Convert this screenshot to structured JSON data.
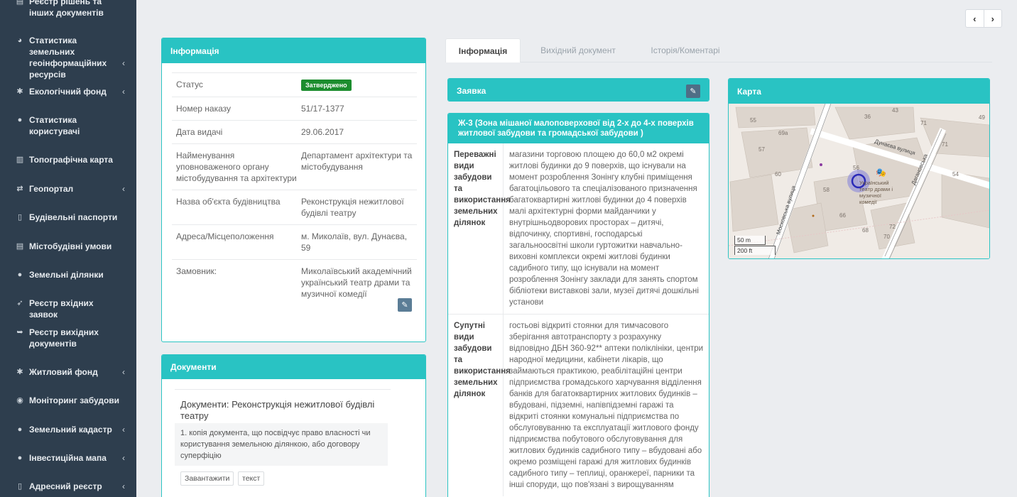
{
  "sidebar": {
    "items": [
      {
        "label": "Реєстр рішень та інших документів",
        "icon": "document-icon",
        "chevron": false
      },
      {
        "label": "Статистика земельних геоінформаційних ресурсів",
        "icon": "pie-chart-icon",
        "chevron": true
      },
      {
        "label": "Екологічний фонд",
        "icon": "tree-icon",
        "chevron": true
      },
      {
        "label": "Статистика користувачі",
        "icon": "user-icon",
        "chevron": false
      },
      {
        "label": "Топографічна карта",
        "icon": "map-icon",
        "chevron": false
      },
      {
        "label": "Геопортал",
        "icon": "retweet-icon",
        "chevron": true
      },
      {
        "label": "Будівельні паспорти",
        "icon": "file-icon",
        "chevron": false
      },
      {
        "label": "Містобудівні умови",
        "icon": "file-text-icon",
        "chevron": false
      },
      {
        "label": "Земельні ділянки",
        "icon": "globe-icon",
        "chevron": false
      },
      {
        "label": "Реєстр вхідних заявок",
        "icon": "send-icon",
        "chevron": false
      },
      {
        "label": "Реєстр вихідних документів",
        "icon": "sign-out-icon",
        "chevron": false
      },
      {
        "label": "Житловий фонд",
        "icon": "asterisk-icon",
        "chevron": true
      },
      {
        "label": "Моніторинг забудови",
        "icon": "eye-icon",
        "chevron": false
      },
      {
        "label": "Земельний кадастр",
        "icon": "globe-icon",
        "chevron": true
      },
      {
        "label": "Інвестиційна мапа",
        "icon": "globe-icon",
        "chevron": true
      },
      {
        "label": "Адресний реєстр",
        "icon": "file-icon",
        "chevron": true
      }
    ]
  },
  "info_panel": {
    "title": "Інформація",
    "rows": [
      {
        "key": "Статус",
        "value": "Затверджено",
        "type": "badge"
      },
      {
        "key": "Номер наказу",
        "value": "51/17-1377",
        "type": "text"
      },
      {
        "key": "Дата видачі",
        "value": "29.06.2017",
        "type": "text"
      },
      {
        "key": "Найменування уповноваженого органу містобудування та архітектури",
        "value": "Департамент архітектури та містобудування",
        "type": "text"
      },
      {
        "key": "Назва об'єкта будівництва",
        "value": "Реконструкція нежитлової будівлі театру",
        "type": "text"
      },
      {
        "key": "Адреса/Місцеположення",
        "value": "м. Миколаїв, вул. Дунаєва, 59",
        "type": "text"
      },
      {
        "key": "Замовник:",
        "value": "Миколаївський академічний український театр драми та музичної комедії",
        "type": "link"
      }
    ]
  },
  "documents_panel": {
    "title": "Документи",
    "doc_title": "Документи: Реконструкція нежитлової будівлі театру",
    "doc_item": "1. копія документа, що посвідчує право власності чи користування земельною ділянкою, або договору суперфіцію",
    "buttons": {
      "download": "Завантажити",
      "text": "текст"
    }
  },
  "tabs": [
    {
      "label": "Інформація",
      "active": true
    },
    {
      "label": "Вихідний документ",
      "active": false
    },
    {
      "label": "Історія/Коментарі",
      "active": false
    }
  ],
  "request_panel": {
    "title": "Заявка"
  },
  "zone_panel": {
    "title": "Ж-3 (Зона мішаної малоповерхової від 2-х до 4-х поверхів житлової забудови та громадської забудови )",
    "rows": [
      {
        "key": "Переважні види забудови та використання земельних ділянок",
        "value": "магазини торговою площею до 60,0 м2 окремі житлові будинки до 9 поверхів, що існували на момент розроблення Зонінгу клубні приміщення багатоцільового та спеціалізованого призначення багатоквартирні житлові будинки до 4 поверхів малі архітектурні форми майданчики у внутрішньодворових просторах – дитячі, відпочинку, спортивні, господарські загальноосвітні школи гуртожитки навчально-виховні комплекси окремі житлові будинки садибного типу, що існували на момент розроблення Зонінгу заклади для занять спортом бібліотеки виставкові зали, музеї дитячі дошкільні установи"
      },
      {
        "key": "Супутні види забудови та використання земельних ділянок",
        "value": "гостьові відкриті стоянки для тимчасового зберігання автотранспорту з розрахунку відповідно ДБН 360-92** аптеки поліклініки, центри народної медицини, кабінети лікарів, що займаються практикою, реабілітаційні центри підприємства громадського харчування відділення банків для багатоквартирних житлових будинків – вбудовані, підземні, напівпідземні гаражі та відкриті стоянки комунальні підприємства по обслуговуванню та експлуатації житлового фонду підприємства побутового обслуговування для житлових будинків садибного типу – вбудовані або окремо розміщені гаражі для житлових будинків садибного типу – теплиці, оранжереї, парники та інші споруди, що пов'язані з вирощуванням"
      }
    ]
  },
  "map_panel": {
    "title": "Карта",
    "streets": {
      "s1": "Дунаєва вулиця",
      "s2": "Московська вулиця",
      "s3": "Дагановська"
    },
    "poi_label": "Український театр драми і музичної комедії",
    "scale_m": "50 m",
    "scale_ft": "200 ft",
    "house_numbers": {
      "n1": "36",
      "n2": "43",
      "n3": "55",
      "n4": "69а",
      "n5": "57",
      "n6": "56",
      "n7": "58",
      "n8": "60",
      "n9": "66",
      "n10": "68",
      "n11": "70",
      "n12": "72",
      "n13": "49",
      "n14": "54",
      "n15": "71",
      "n16": "71"
    }
  },
  "colors": {
    "sidebar_bg": "#2e3e4e",
    "accent": "#29c3c3",
    "badge": "#1c8d2e",
    "link": "#2a8ccf"
  }
}
